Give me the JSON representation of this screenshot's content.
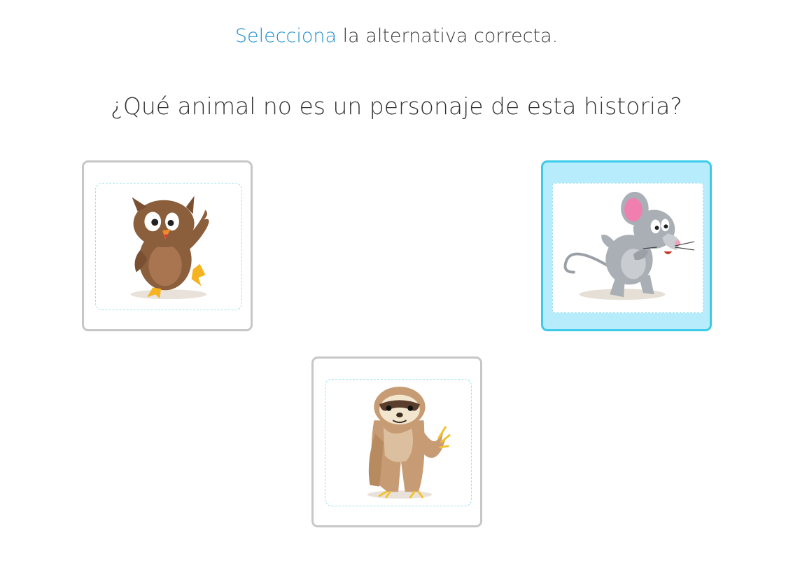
{
  "instruction": {
    "verb": "Selecciona",
    "rest": " la alternativa correcta."
  },
  "question": "¿Qué animal no es un personaje de esta historia?",
  "options": [
    {
      "id": "owl",
      "image": "owl-illustration",
      "selected": false
    },
    {
      "id": "mouse",
      "image": "mouse-illustration",
      "selected": true
    },
    {
      "id": "sloth",
      "image": "sloth-illustration",
      "selected": false
    }
  ],
  "colors": {
    "accent": "#1e8fd0",
    "selected_border": "#3ccbe8",
    "selected_fill": "#b6ecfb",
    "card_border": "#c7c7c7",
    "dashed_frame": "#9fdff0"
  }
}
